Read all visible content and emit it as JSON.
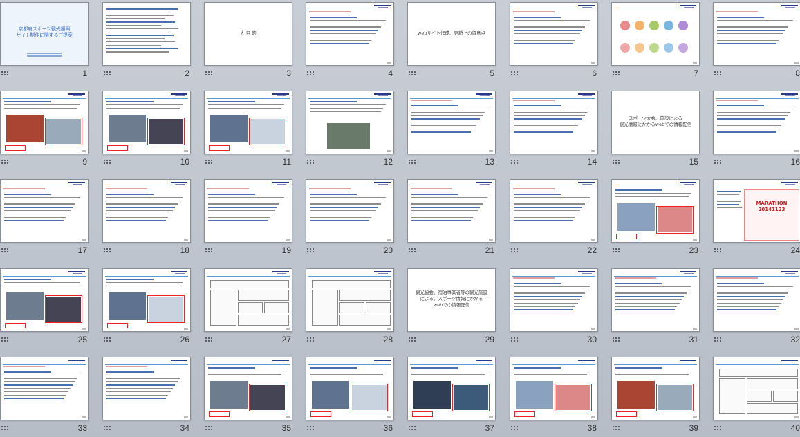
{
  "panel": "slide-sorter",
  "slides": [
    {
      "number": "1",
      "kind": "title",
      "title": "京都府スポーツ観光振興\nサイト制作に関するご提案"
    },
    {
      "number": "2",
      "kind": "toc"
    },
    {
      "number": "3",
      "kind": "section",
      "title": "大 目 的"
    },
    {
      "number": "4",
      "kind": "text"
    },
    {
      "number": "5",
      "kind": "section",
      "title": "webサイト作成、更新上の留意点"
    },
    {
      "number": "6",
      "kind": "text"
    },
    {
      "number": "7",
      "kind": "circles"
    },
    {
      "number": "8",
      "kind": "text"
    },
    {
      "number": "9",
      "kind": "screens"
    },
    {
      "number": "10",
      "kind": "screens"
    },
    {
      "number": "11",
      "kind": "screens"
    },
    {
      "number": "12",
      "kind": "photo"
    },
    {
      "number": "13",
      "kind": "text"
    },
    {
      "number": "14",
      "kind": "text"
    },
    {
      "number": "15",
      "kind": "section",
      "title": "スポーツ大会、施設による\n観光情報にかかるwebでの情報配信"
    },
    {
      "number": "16",
      "kind": "text"
    },
    {
      "number": "17",
      "kind": "text"
    },
    {
      "number": "18",
      "kind": "text"
    },
    {
      "number": "19",
      "kind": "text"
    },
    {
      "number": "20",
      "kind": "text"
    },
    {
      "number": "21",
      "kind": "text"
    },
    {
      "number": "22",
      "kind": "text"
    },
    {
      "number": "23",
      "kind": "screens"
    },
    {
      "number": "24",
      "kind": "marathon",
      "title": "MARATHON\n20141123"
    },
    {
      "number": "25",
      "kind": "screens"
    },
    {
      "number": "26",
      "kind": "screens"
    },
    {
      "number": "27",
      "kind": "wireframe"
    },
    {
      "number": "28",
      "kind": "wireframe"
    },
    {
      "number": "29",
      "kind": "section",
      "title": "観光協会、宿泊事業者等の観光施設\nによる、スポーツ情報にかかる\nwebでの情報配信"
    },
    {
      "number": "30",
      "kind": "text"
    },
    {
      "number": "31",
      "kind": "text"
    },
    {
      "number": "32",
      "kind": "text"
    },
    {
      "number": "33",
      "kind": "text"
    },
    {
      "number": "34",
      "kind": "text"
    },
    {
      "number": "35",
      "kind": "screens"
    },
    {
      "number": "36",
      "kind": "screens"
    },
    {
      "number": "37",
      "kind": "screens"
    },
    {
      "number": "38",
      "kind": "screens"
    },
    {
      "number": "39",
      "kind": "screens"
    },
    {
      "number": "40",
      "kind": "wireframe"
    }
  ],
  "colors": {
    "background": "#c3c9d1",
    "accent_blue": "#1f4e9a",
    "accent_red": "#dd2222",
    "thumb_border": "#8a909a"
  }
}
